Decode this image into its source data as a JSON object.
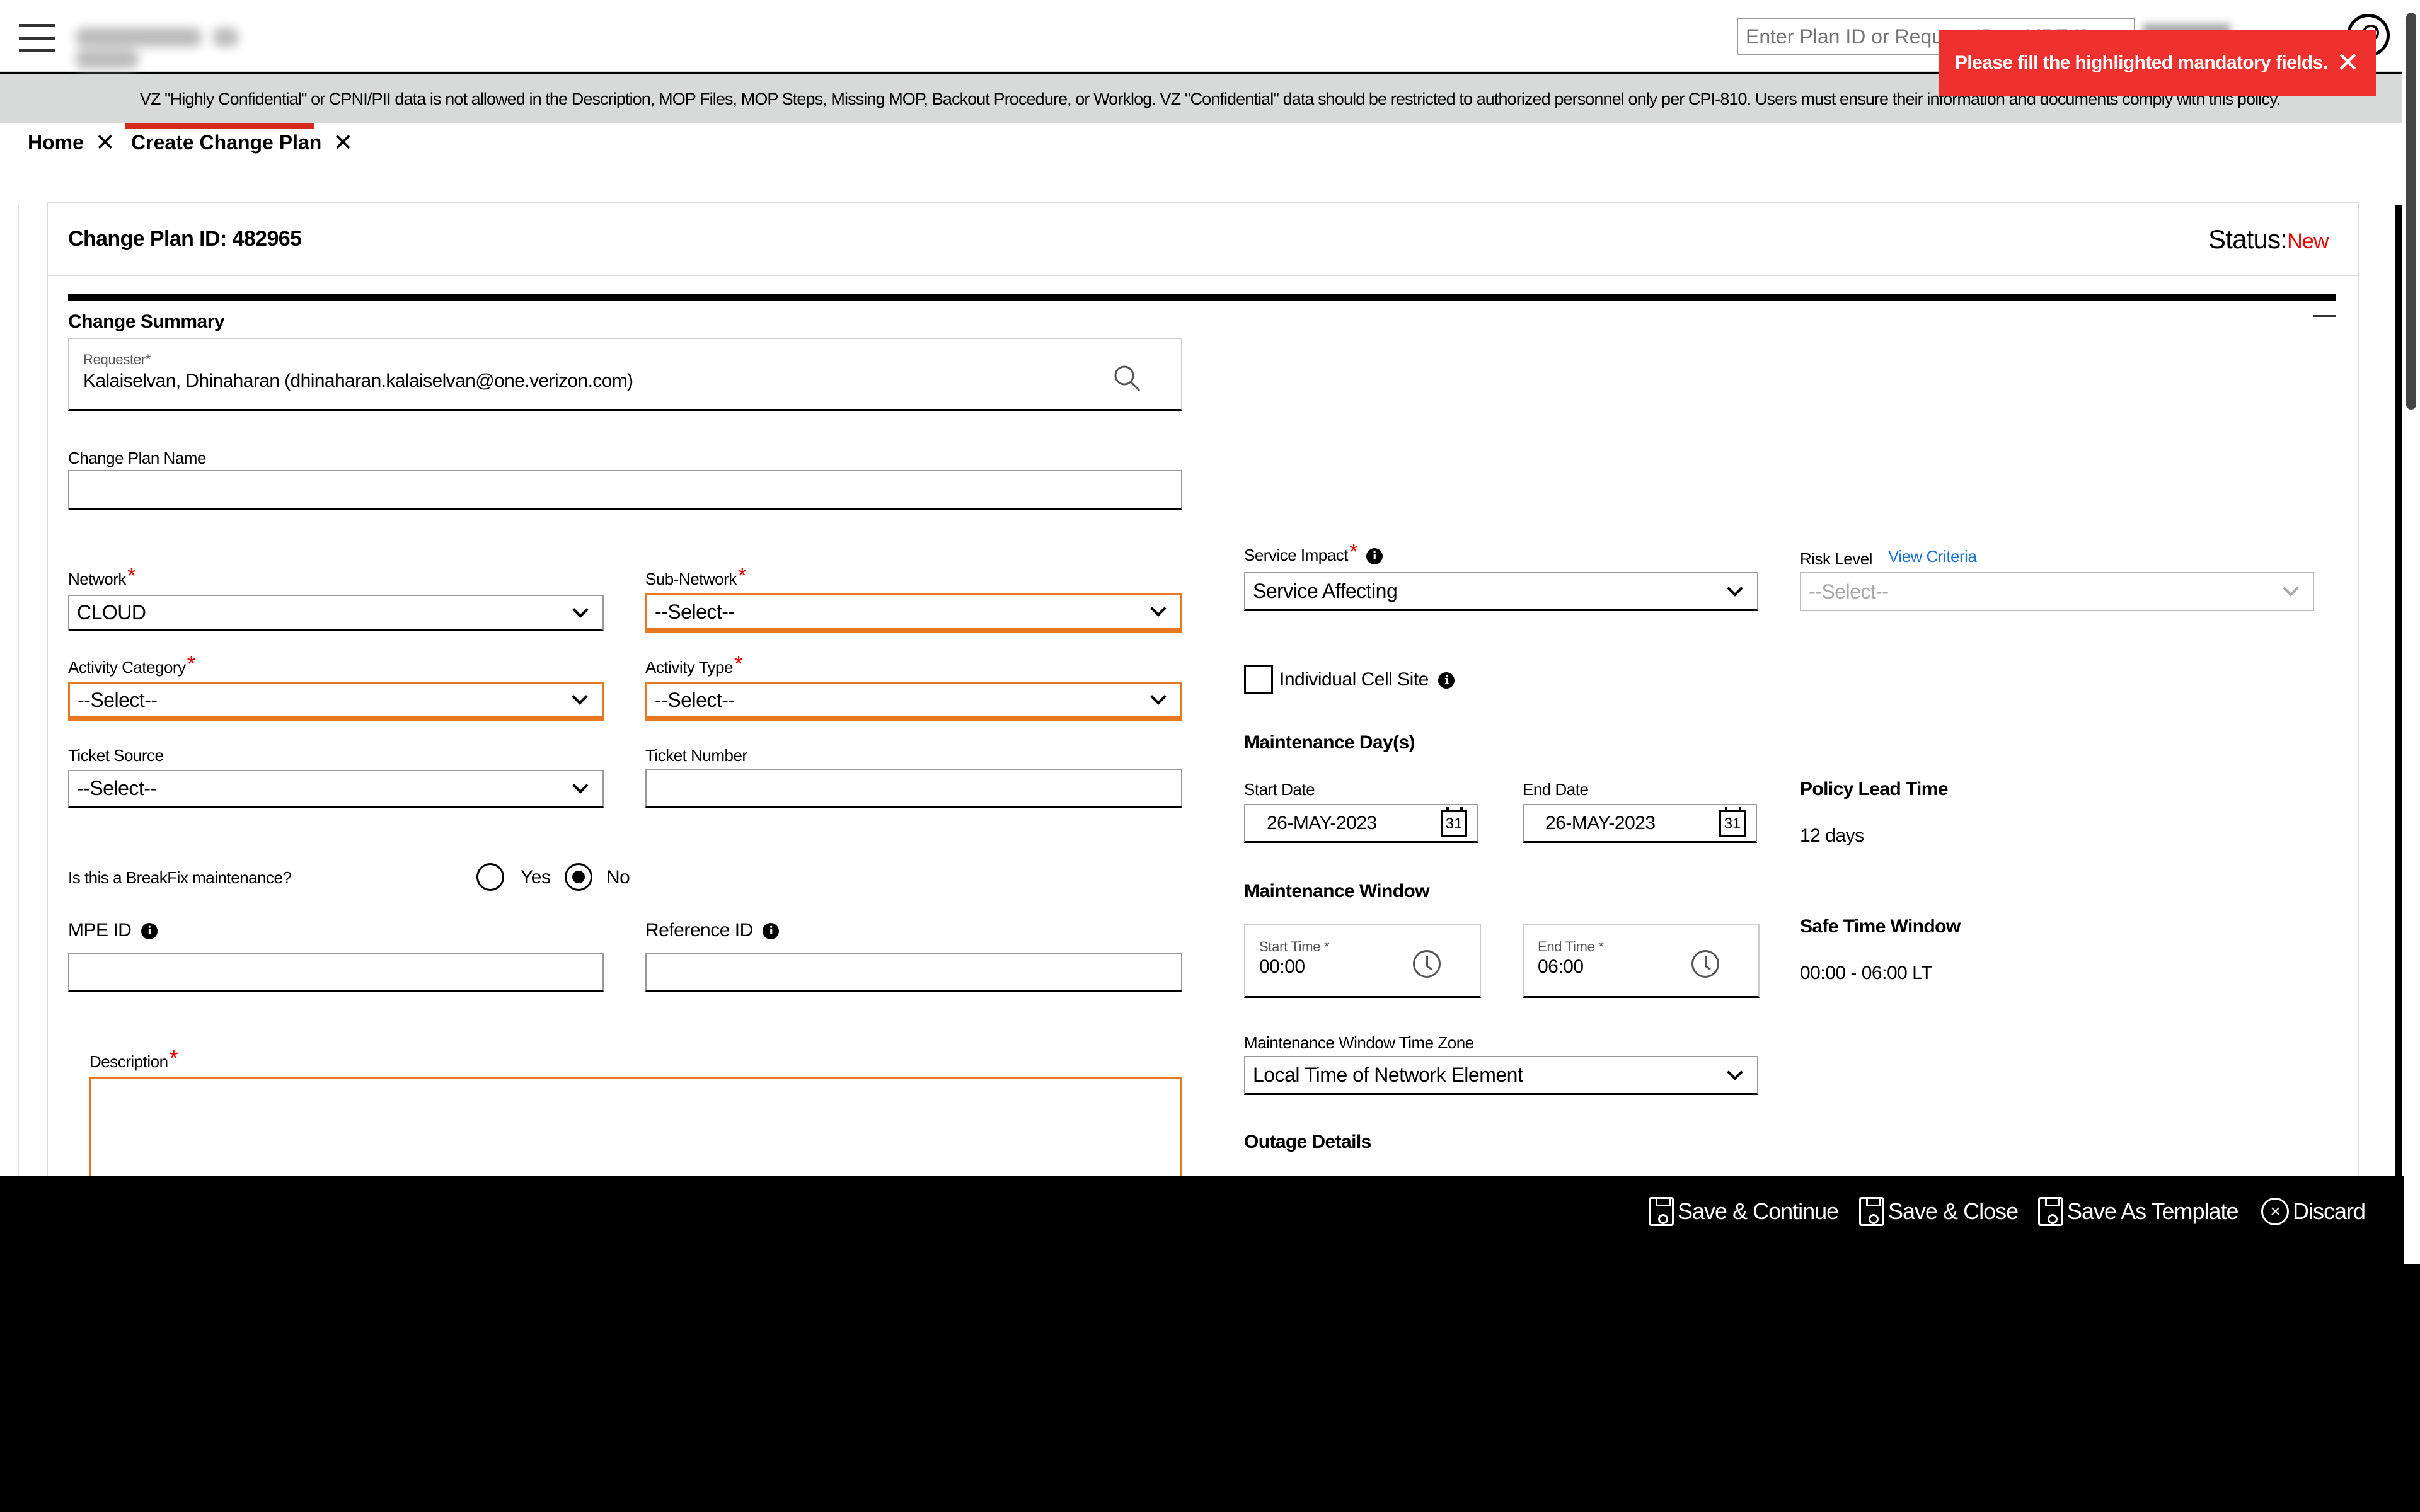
{
  "header": {
    "search_placeholder": "Enter Plan ID or Request ID or MPE ID",
    "search_value": "Enter Plan ID or Request ID or MPE ID"
  },
  "banner": {
    "text": "VZ \"Highly Confidential\" or CPNI/PII data is not allowed in the Description, MOP Files, MOP Steps, Missing MOP, Backout Procedure, or Worklog. VZ \"Confidential\" data should be restricted to authorized personnel only per CPI-810. Users must ensure their information and documents comply with this policy."
  },
  "toast": {
    "message": "Please fill the highlighted mandatory fields."
  },
  "tabs": [
    {
      "label": "Home"
    },
    {
      "label": "Create Change Plan"
    }
  ],
  "card": {
    "plan_id_label": "Change Plan ID: 482965",
    "status_label": "Status:",
    "status_value": "New",
    "status_color": "#ee0000",
    "section_title": "Change Summary"
  },
  "form": {
    "requester_label": "Requester*",
    "requester_value": "Kalaiselvan, Dhinaharan (dhinaharan.kalaiselvan@one.verizon.com)",
    "change_plan_name_label": "Change Plan Name",
    "change_plan_name_value": "",
    "network_label": "Network",
    "network_value": "CLOUD",
    "sub_network_label": "Sub-Network",
    "sub_network_value": "--Select--",
    "activity_category_label": "Activity Category",
    "activity_category_value": "--Select--",
    "activity_type_label": "Activity Type",
    "activity_type_value": "--Select--",
    "ticket_source_label": "Ticket Source",
    "ticket_source_value": "--Select--",
    "ticket_number_label": "Ticket Number",
    "ticket_number_value": "",
    "breakfix_question": "Is this a BreakFix maintenance?",
    "breakfix_options": [
      "Yes",
      "No"
    ],
    "breakfix_selected": "No",
    "mpe_id_label": "MPE ID",
    "reference_id_label": "Reference ID",
    "description_label": "Description",
    "service_impact_label": "Service Impact",
    "service_impact_value": "Service Affecting",
    "risk_level_label": "Risk Level",
    "view_criteria_link": "View Criteria",
    "risk_level_value": "--Select--",
    "individual_cell_site_label": "Individual Cell Site",
    "maintenance_days_title": "Maintenance Day(s)",
    "start_date_label": "Start Date",
    "start_date_value": "26-MAY-2023",
    "end_date_label": "End Date",
    "end_date_value": "26-MAY-2023",
    "calendar_day": "31",
    "policy_lead_time_title": "Policy Lead Time",
    "policy_lead_time_value": "12 days",
    "maintenance_window_title": "Maintenance Window",
    "start_time_label": "Start Time *",
    "start_time_value": "00:00",
    "end_time_label": "End Time *",
    "end_time_value": "06:00",
    "safe_time_window_title": "Safe Time Window",
    "safe_time_window_value": "00:00 - 06:00 LT",
    "time_zone_label": "Maintenance Window Time Zone",
    "time_zone_value": "Local Time of Network Element",
    "outage_details_title": "Outage Details"
  },
  "footer": {
    "actions": [
      "Save & Continue",
      "Save & Close",
      "Save As Template",
      "Discard"
    ]
  },
  "colors": {
    "error_orange": "#e87722",
    "brand_red": "#ee312f",
    "link_blue": "#1670d6"
  },
  "icons": [
    "hamburger-icon",
    "search-icon",
    "user-icon",
    "close-icon",
    "chevron-down-icon",
    "info-icon",
    "calendar-icon",
    "clock-icon",
    "save-icon",
    "discard-icon"
  ]
}
